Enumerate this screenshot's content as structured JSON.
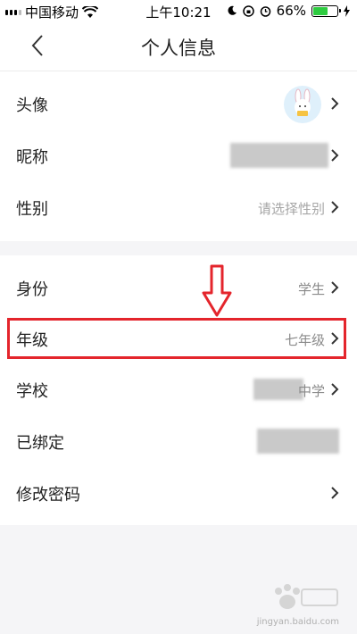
{
  "status_bar": {
    "carrier": "中国移动",
    "time": "上午10:21",
    "battery_percent": "66%",
    "battery_level": 0.66,
    "battery_color": "#2ecc40"
  },
  "nav": {
    "title": "个人信息",
    "back_icon": "chevron-left-icon"
  },
  "profile_group": {
    "avatar": {
      "label": "头像"
    },
    "nickname": {
      "label": "昵称"
    },
    "gender": {
      "label": "性别",
      "placeholder": "请选择性别"
    }
  },
  "account_group": {
    "identity": {
      "label": "身份",
      "value": "学生"
    },
    "grade": {
      "label": "年级",
      "value": "七年级"
    },
    "school": {
      "label": "学校",
      "value_suffix": "中学"
    },
    "bound": {
      "label": "已绑定"
    },
    "change_password": {
      "label": "修改密码"
    }
  },
  "annotation": {
    "highlight_color": "#e4252c"
  },
  "watermark": {
    "url": "jingyan.baidu.com"
  }
}
